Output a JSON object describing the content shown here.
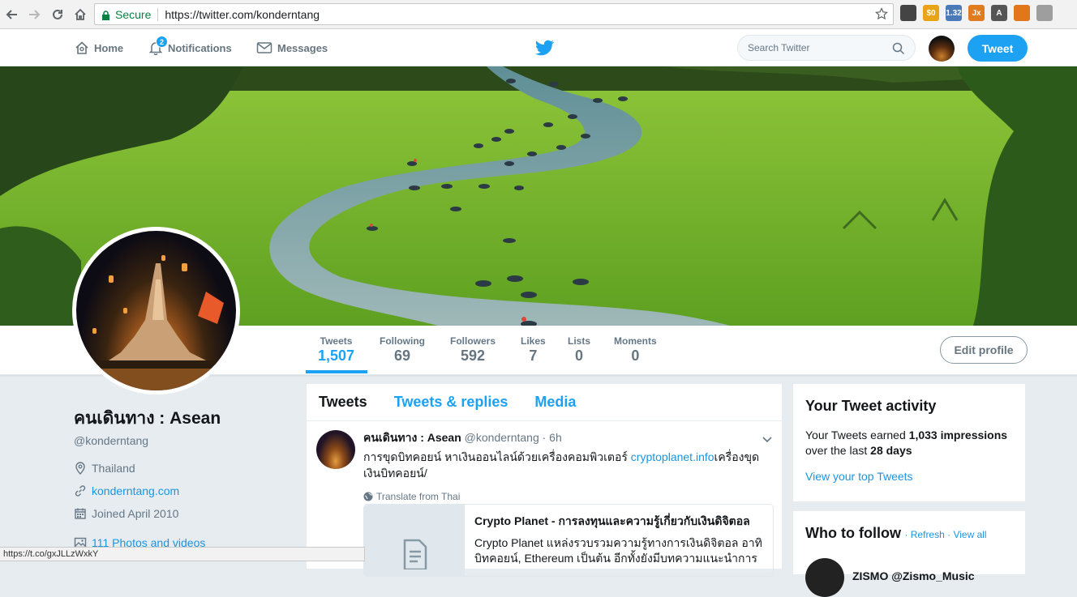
{
  "browser": {
    "secure_label": "Secure",
    "url": "https://twitter.com/konderntang",
    "extensions": [
      {
        "name": "qr-extension",
        "label": "",
        "color": "#444444"
      },
      {
        "name": "coin-extension",
        "label": "$0",
        "color": "#e8a317"
      },
      {
        "name": "speed-extension",
        "label": "1.32",
        "color": "#4a7ab8"
      },
      {
        "name": "jx-extension",
        "label": "Jx",
        "color": "#e07b1f"
      },
      {
        "name": "a-extension",
        "label": "A",
        "color": "#555555"
      },
      {
        "name": "fox-extension",
        "label": "",
        "color": "#e2761b"
      },
      {
        "name": "gray-extension",
        "label": "",
        "color": "#9e9e9e"
      }
    ]
  },
  "nav": {
    "home": "Home",
    "notifications": "Notifications",
    "notifications_count": "2",
    "messages": "Messages",
    "search_placeholder": "Search Twitter",
    "tweet_button": "Tweet"
  },
  "profile": {
    "name": "คนเดินทาง : Asean",
    "handle": "@konderntang",
    "location": "Thailand",
    "website": "konderntang.com",
    "joined": "Joined April 2010",
    "media": "111 Photos and videos",
    "edit_button": "Edit profile"
  },
  "stats": [
    {
      "label": "Tweets",
      "value": "1,507"
    },
    {
      "label": "Following",
      "value": "69"
    },
    {
      "label": "Followers",
      "value": "592"
    },
    {
      "label": "Likes",
      "value": "7"
    },
    {
      "label": "Lists",
      "value": "0"
    },
    {
      "label": "Moments",
      "value": "0"
    }
  ],
  "timeline": {
    "tabs": [
      "Tweets",
      "Tweets & replies",
      "Media"
    ],
    "tweet": {
      "name": "คนเดินทาง : Asean",
      "handle_time": "@konderntang · 6h",
      "text_before": "การขุดบิทคอยน์ หาเงินออนไลน์ด้วยเครื่องคอมพิวเตอร์ ",
      "text_link": "cryptoplanet.info",
      "text_after": "เครื่องขุดเงินบิทคอยน์/",
      "translate": "Translate from Thai",
      "card_title": "Crypto Planet - การลงทุนและความรู้เกี่ยวกับเงินดิจิตอล",
      "card_desc": "Crypto Planet แหล่งรวบรวมความรู้ทางการเงินดิจิตอล อาทิ บิทคอยน์, Ethereum เป็นต้น อีกทั้งยังมีบทความแนะนำการ"
    }
  },
  "activity": {
    "title": "Your Tweet activity",
    "text_1": "Your Tweets earned ",
    "impressions": "1,033 impressions",
    "text_2": "over the last ",
    "days": "28 days",
    "link": "View your top Tweets"
  },
  "who_to_follow": {
    "title": "Who to follow",
    "refresh": "Refresh",
    "view_all": "View all",
    "first": "ZISMO @Zismo_Music"
  },
  "status_bar": "https://t.co/gxJLLzWxkY",
  "colors": {
    "accent": "#1da1f2",
    "link": "#1b95e0",
    "background": "#e6ecf0"
  }
}
